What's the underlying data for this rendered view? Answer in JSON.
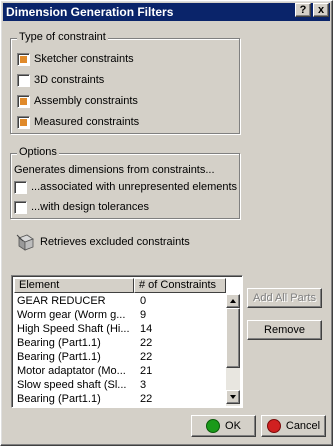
{
  "window": {
    "title": "Dimension Generation Filters",
    "help_label": "?",
    "close_label": "x"
  },
  "type_group": {
    "legend": "Type of constraint",
    "items": [
      {
        "label": "Sketcher constraints",
        "checked": true
      },
      {
        "label": "3D constraints",
        "checked": false
      },
      {
        "label": "Assembly constraints",
        "checked": true
      },
      {
        "label": "Measured constraints",
        "checked": true
      }
    ]
  },
  "options_group": {
    "legend": "Options",
    "description": "Generates dimensions from constraints...",
    "items": [
      {
        "label": "...associated with unrepresented elements",
        "checked": false
      },
      {
        "label": "...with design tolerances",
        "checked": false
      }
    ]
  },
  "excluded": {
    "label": "Retrieves excluded constraints",
    "icon": "excluded-constraints-icon"
  },
  "list": {
    "columns": [
      "Element",
      "# of Constraints"
    ],
    "rows": [
      [
        "GEAR REDUCER",
        "0"
      ],
      [
        "Worm gear (Worm g...",
        "9"
      ],
      [
        "High Speed Shaft (Hi...",
        "14"
      ],
      [
        "Bearing (Part1.1)",
        "22"
      ],
      [
        "Bearing (Part1.1)",
        "22"
      ],
      [
        "Motor adaptator (Mo...",
        "21"
      ],
      [
        "Slow speed shaft (Sl...",
        "3"
      ],
      [
        "Bearing (Part1.1)",
        "22"
      ]
    ]
  },
  "buttons": {
    "add_all_parts": "Add All Parts",
    "remove": "Remove",
    "ok": "OK",
    "cancel": "Cancel"
  },
  "colors": {
    "title_bar": "#0a246a",
    "check_mark": "#e08a2a",
    "ok_icon": "#1a9a1a",
    "cancel_icon": "#d02020"
  }
}
